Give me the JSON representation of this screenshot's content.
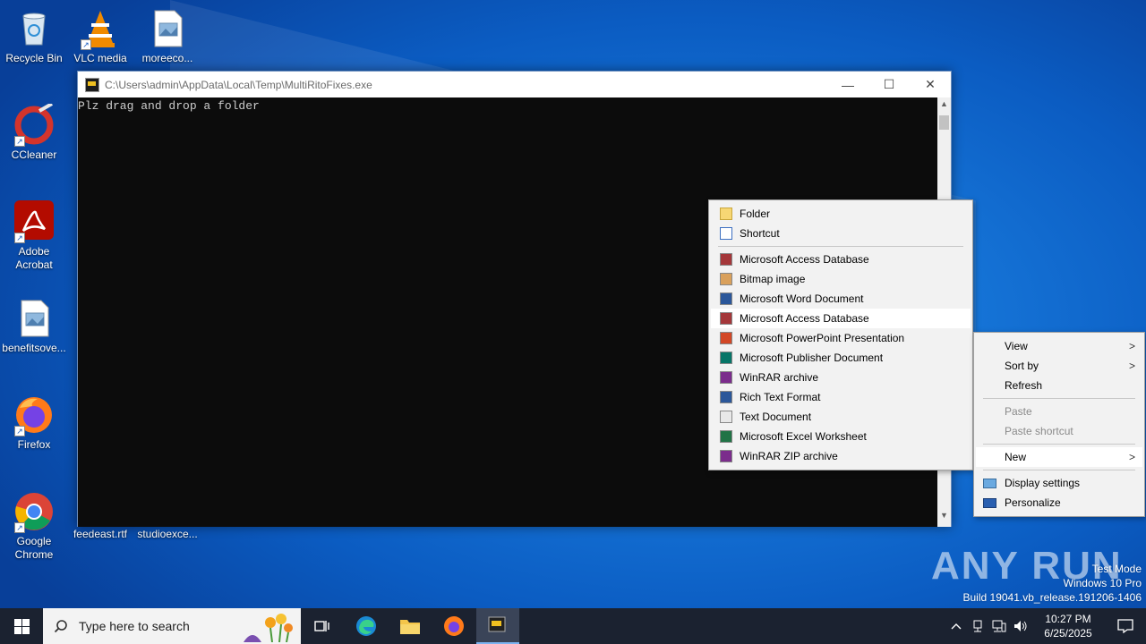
{
  "desktop_icons": [
    {
      "label": "Recycle Bin",
      "icon": "recycle-bin-icon"
    },
    {
      "label": "VLC media",
      "icon": "vlc-icon"
    },
    {
      "label": "moreeco...",
      "icon": "image-file-icon"
    },
    {
      "label": "CCleaner",
      "icon": "ccleaner-icon"
    },
    {
      "label": "Adobe Acrobat",
      "icon": "adobe-acrobat-icon"
    },
    {
      "label": "benefitsove...",
      "icon": "image-file-icon"
    },
    {
      "label": "Firefox",
      "icon": "firefox-icon"
    },
    {
      "label": "Google Chrome",
      "icon": "chrome-icon"
    },
    {
      "label": "feedeast.rtf",
      "icon": "rtf-file-icon"
    },
    {
      "label": "studioexce...",
      "icon": "excel-file-icon"
    }
  ],
  "console": {
    "title": "C:\\Users\\admin\\AppData\\Local\\Temp\\MultiRitoFixes.exe",
    "text": "Plz drag and drop a folder",
    "minimize": "—",
    "maximize": "☐",
    "close": "✕"
  },
  "new_submenu": {
    "items": [
      {
        "label": "Folder",
        "color": "#f7d774"
      },
      {
        "label": "Shortcut",
        "color": "#3c6fc1"
      },
      {
        "label": "Microsoft Access Database",
        "color": "#a4373a"
      },
      {
        "label": "Bitmap image",
        "color": "#d9a05b"
      },
      {
        "label": "Microsoft Word Document",
        "color": "#2b579a"
      },
      {
        "label": "Microsoft Access Database",
        "color": "#a4373a",
        "highlighted": true
      },
      {
        "label": "Microsoft PowerPoint Presentation",
        "color": "#d24726"
      },
      {
        "label": "Microsoft Publisher Document",
        "color": "#077568"
      },
      {
        "label": "WinRAR archive",
        "color": "#7b2c8c"
      },
      {
        "label": "Rich Text Format",
        "color": "#2b579a"
      },
      {
        "label": "Text Document",
        "color": "#e8e8e8"
      },
      {
        "label": "Microsoft Excel Worksheet",
        "color": "#217346"
      },
      {
        "label": "WinRAR ZIP archive",
        "color": "#7b2c8c"
      }
    ]
  },
  "context_menu": {
    "view": "View",
    "sort_by": "Sort by",
    "refresh": "Refresh",
    "paste": "Paste",
    "paste_shortcut": "Paste shortcut",
    "new": "New",
    "display_settings": "Display settings",
    "personalize": "Personalize"
  },
  "taskbar": {
    "search_placeholder": "Type here to search",
    "time": "10:27 PM",
    "date": "6/25/2025"
  },
  "watermark": {
    "brand": "ANY RUN",
    "line1": "Test Mode",
    "line2": "Windows 10 Pro",
    "line3": "Build 19041.vb_release.191206-1406"
  }
}
